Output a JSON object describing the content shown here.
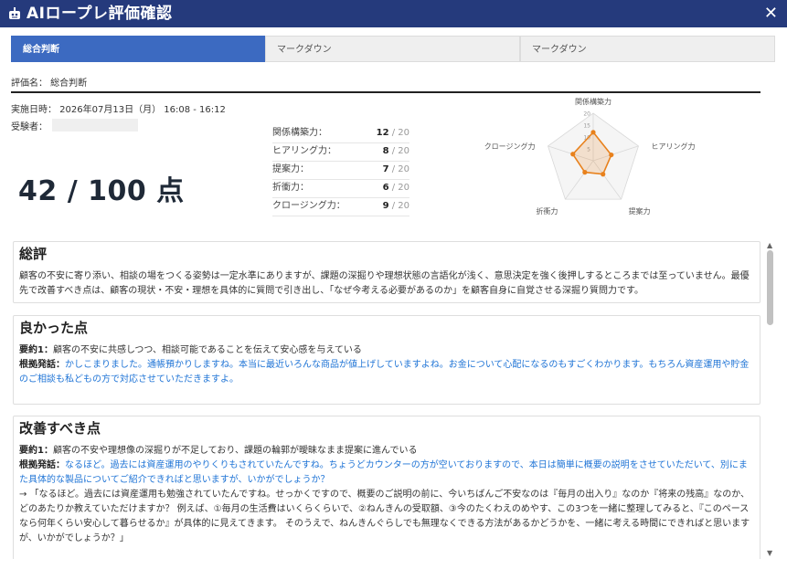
{
  "window": {
    "title": "AIロープレ評価確認",
    "close_label": "✕"
  },
  "tabs": [
    {
      "label": "総合判断",
      "active": true
    },
    {
      "label": "マークダウン",
      "active": false
    },
    {
      "label": "マークダウン",
      "active": false
    }
  ],
  "evaluation": {
    "name_line": "評価名：  総合判断",
    "date_line": "実施日時：  2026年07月13日（月）  16:08 - 16:12",
    "examinee_label": "受験者：",
    "total": "42 / 100 点"
  },
  "scores": [
    {
      "label": "関係構築力：",
      "value": "12",
      "max": "/ 20"
    },
    {
      "label": "ヒアリング力：",
      "value": "8",
      "max": "/ 20"
    },
    {
      "label": "提案力：",
      "value": "7",
      "max": "/ 20"
    },
    {
      "label": "折衝力：",
      "value": "6",
      "max": "/ 20"
    },
    {
      "label": "クロージング力：",
      "value": "9",
      "max": "/ 20"
    }
  ],
  "chart_data": {
    "type": "radar",
    "axes": [
      "関係構築力",
      "ヒアリング力",
      "提案力",
      "折衝力",
      "クロージング力"
    ],
    "values": [
      12,
      8,
      7,
      6,
      9
    ],
    "ticks": [
      "20",
      "15",
      "10",
      "5"
    ],
    "range": [
      0,
      20
    ],
    "line_color": "#e8811c"
  },
  "sections": {
    "summary": {
      "title": "総評",
      "text": "顧客の不安に寄り添い、相談の場をつくる姿勢は一定水準にありますが、課題の深掘りや理想状態の言語化が浅く、意思決定を強く後押しするところまでは至っていません。最優先で改善すべき点は、顧客の現状・不安・理想を具体的に質問で引き出し、「なぜ今考える必要があるのか」を顧客自身に自覚させる深掘り質問力です。"
    },
    "good": {
      "title": "良かった点",
      "summary_label": "要約1：",
      "summary": "顧客の不安に共感しつつ、相談可能であることを伝えて安心感を与えている",
      "evidence_label": "根拠発話：",
      "evidence": "かしこまりました。通帳預かりしますね。本当に最近いろんな商品が値上げしていますよね。お金について心配になるのもすごくわかります。もちろん資産運用や貯金のご相談も私どもの方で対応させていただきますよ。"
    },
    "improve": {
      "title": "改善すべき点",
      "summary_label": "要約1：",
      "summary": "顧客の不安や理想像の深掘りが不足しており、課題の輪郭が曖昧なまま提案に進んでいる",
      "evidence_label": "根拠発話：",
      "evidence": "なるほど。過去には資産運用のやりくりもされていたんですね。ちょうどカウンターの方が空いておりますので、本日は簡単に概要の説明をさせていただいて、別にまた具体的な製品についてご紹介できればと思いますが、いかがでしょうか？",
      "suggestion": "→ 「なるほど。過去には資産運用も勉強されていたんですね。せっかくですので、概要のご説明の前に、今いちばんご不安なのは『毎月の出入り』なのか『将来の残高』なのか、どのあたりか教えていただけますか？ 例えば、①毎月の生活費はいくらくらいで、②ねんきんの受取額、③今のたくわえのめやす、この3つを一緒に整理してみると、『このペースなら何年くらい安心して暮らせるか』が具体的に見えてきます。 そのうえで、ねんきんぐらしでも無理なくできる方法があるかどうかを、一緒に考える時間にできればと思いますが、いかがでしょうか？」"
    }
  }
}
